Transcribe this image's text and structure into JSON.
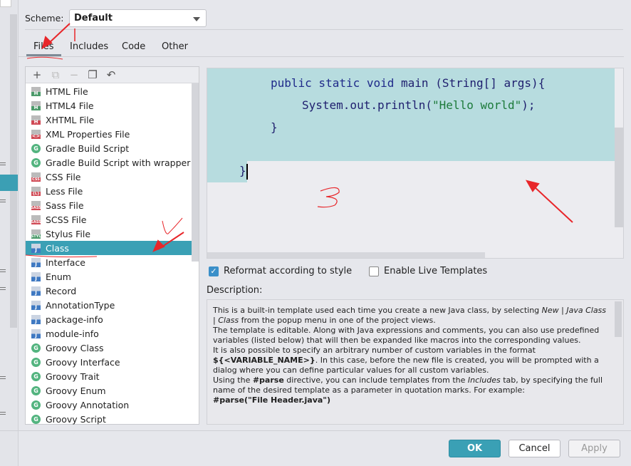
{
  "scheme": {
    "label": "Scheme:",
    "value": "Default"
  },
  "tabs": [
    "Files",
    "Includes",
    "Code",
    "Other"
  ],
  "toolbar": {
    "add": "+",
    "copy": "⧉",
    "remove": "−",
    "duplicate": "❐",
    "reset": "↶"
  },
  "templates": [
    {
      "label": "HTML File",
      "icon": "html-file-icon",
      "tag": "H",
      "color": "#4c9a6a"
    },
    {
      "label": "HTML4 File",
      "icon": "html-file-icon",
      "tag": "H",
      "color": "#4c9a6a"
    },
    {
      "label": "XHTML File",
      "icon": "xhtml-file-icon",
      "tag": "H",
      "color": "#d04a55"
    },
    {
      "label": "XML Properties File",
      "icon": "xml-file-icon",
      "tag": "<>",
      "color": "#d04a55"
    },
    {
      "label": "Gradle Build Script",
      "icon": "gradle-icon",
      "tag": "G",
      "color": "#53b47f"
    },
    {
      "label": "Gradle Build Script with wrapper",
      "icon": "gradle-icon",
      "tag": "G",
      "color": "#53b47f"
    },
    {
      "label": "CSS File",
      "icon": "css-file-icon",
      "tag": "CSS",
      "color": "#d04a55"
    },
    {
      "label": "Less File",
      "icon": "less-file-icon",
      "tag": "{L}",
      "color": "#d04a55"
    },
    {
      "label": "Sass File",
      "icon": "sass-file-icon",
      "tag": "SASS",
      "color": "#d04a55"
    },
    {
      "label": "SCSS File",
      "icon": "scss-file-icon",
      "tag": "SASS",
      "color": "#d04a55"
    },
    {
      "label": "Stylus File",
      "icon": "stylus-file-icon",
      "tag": "STYL",
      "color": "#4c9a6a"
    },
    {
      "label": "Class",
      "icon": "java-class-icon",
      "tag": "J",
      "color": "#3f79c2",
      "selected": true
    },
    {
      "label": "Interface",
      "icon": "java-class-icon",
      "tag": "J",
      "color": "#3f79c2"
    },
    {
      "label": "Enum",
      "icon": "java-class-icon",
      "tag": "J",
      "color": "#3f79c2"
    },
    {
      "label": "Record",
      "icon": "java-class-icon",
      "tag": "J",
      "color": "#3f79c2"
    },
    {
      "label": "AnnotationType",
      "icon": "java-class-icon",
      "tag": "J",
      "color": "#3f79c2"
    },
    {
      "label": "package-info",
      "icon": "java-class-icon",
      "tag": "J",
      "color": "#3f79c2"
    },
    {
      "label": "module-info",
      "icon": "java-class-icon",
      "tag": "J",
      "color": "#3f79c2"
    },
    {
      "label": "Groovy Class",
      "icon": "groovy-icon",
      "tag": "G",
      "color": "#53b47f"
    },
    {
      "label": "Groovy Interface",
      "icon": "groovy-icon",
      "tag": "G",
      "color": "#53b47f"
    },
    {
      "label": "Groovy Trait",
      "icon": "groovy-icon",
      "tag": "G",
      "color": "#53b47f"
    },
    {
      "label": "Groovy Enum",
      "icon": "groovy-icon",
      "tag": "G",
      "color": "#53b47f"
    },
    {
      "label": "Groovy Annotation",
      "icon": "groovy-icon",
      "tag": "G",
      "color": "#53b47f"
    },
    {
      "label": "Groovy Script",
      "icon": "groovy-icon",
      "tag": "G",
      "color": "#53b47f"
    }
  ],
  "editor": {
    "lines": [
      {
        "kw": "public static void ",
        "rest": "main (String[] args){"
      },
      {
        "pre": "System.out.println(",
        "str": "\"Hello world\"",
        "post": ");"
      },
      {
        "rest": "}"
      },
      {
        "rest": "}"
      }
    ]
  },
  "options": {
    "reformat": {
      "label": "Reformat according to style",
      "checked": true
    },
    "live_templates": {
      "label": "Enable Live Templates",
      "checked": false
    }
  },
  "description": {
    "label": "Description:",
    "p1a": "This is a built-in template used each time you create a new Java class, by selecting ",
    "p1i": "New | Java Class | Class",
    "p1b": " from the popup menu in one of the project views.",
    "p2": "The template is editable. Along with Java expressions and comments, you can also use predefined variables (listed below) that will then be expanded like macros into the corresponding values.",
    "p3a": "It is also possible to specify an arbitrary number of custom variables in the format ",
    "p3b": "${<VARIABLE_NAME>}",
    "p3c": ". In this case, before the new file is created, you will be prompted with a dialog where you can define particular values for all custom variables.",
    "p4a": "Using the ",
    "p4b": "#parse",
    "p4c": " directive, you can include templates from the ",
    "p4i": "Includes",
    "p4d": " tab, by specifying the full name of the desired template as a parameter in quotation marks. For example:",
    "p5": "#parse(\"File Header.java\")"
  },
  "buttons": {
    "ok": "OK",
    "cancel": "Cancel",
    "apply": "Apply"
  },
  "colors": {
    "accent": "#3aa0b5",
    "selection": "#b7dcdf",
    "annotation": "#e8262a"
  }
}
